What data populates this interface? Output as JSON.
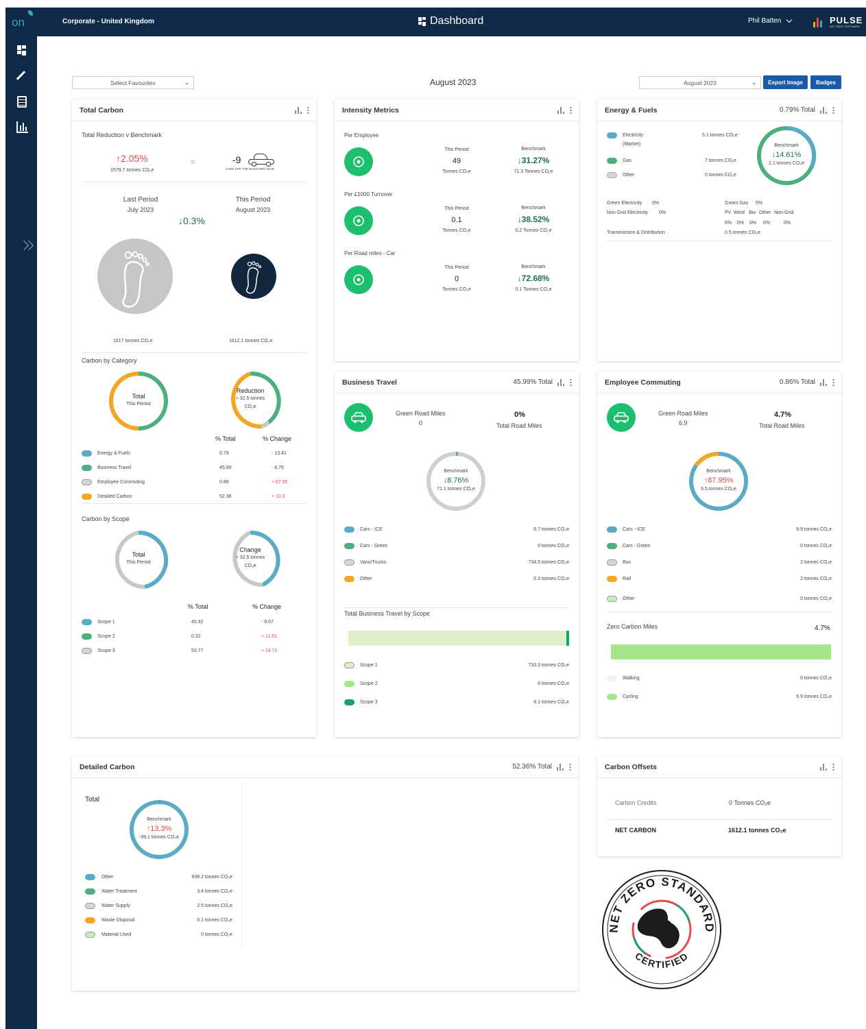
{
  "topbar": {
    "logo": "on",
    "org": "Corporate - United Kingdom",
    "title": "Dashboard",
    "user": "Phil Batten",
    "brand": "PULSE",
    "brand_sub": "NET ZERO SOFTWARE"
  },
  "controls": {
    "favourites": "Select Favourites",
    "period_heading": "August 2023",
    "period_select": "August 2023",
    "export_label": "Export Image",
    "badges_label": "Badges"
  },
  "total_carbon": {
    "title": "Total Carbon",
    "reduction_label": "Total Reduction v Benchmark",
    "pct": "↑2.05%",
    "pct_tonnes": "1579.7 tonnes CO₂e",
    "equals": "=",
    "cars": "-9",
    "cars_label": "CARS OFF THE ROAD PER YEAR",
    "last_label": "Last Period",
    "last_month": "July 2023",
    "this_label": "This Period",
    "this_month": "August 2023",
    "change": "↓0.3%",
    "last_tonnes": "1617 tonnes CO₂e",
    "this_tonnes": "1612.1 tonnes CO₂e",
    "cat_heading": "Carbon by Category",
    "donut_total": "Total",
    "donut_total_sub": "This Period",
    "donut_red": "Reduction",
    "donut_red_sub": "+ 32.5 tonnes",
    "donut_red_sub2": "CO₂e",
    "col_total": "% Total",
    "col_change": "% Change",
    "categories": [
      {
        "name": "Energy & Fuels",
        "total": "0.79",
        "change": "- 13.41"
      },
      {
        "name": "Business Travel",
        "total": "45.99",
        "change": "- 8.76"
      },
      {
        "name": "Employee Commuting",
        "total": "0.86",
        "change": "+ 87.95"
      },
      {
        "name": "Detailed Carbon",
        "total": "52.36",
        "change": "+ 13.3"
      }
    ],
    "scope_heading": "Carbon by Scope",
    "donut2_total": "Total",
    "donut2_total_sub": "This Period",
    "donut2_change": "Change",
    "donut2_change_sub": "+ 32.5 tonnes",
    "donut2_change_sub2": "CO₂e",
    "col2_total": "% Total",
    "col2_change": "% Change",
    "scopes": [
      {
        "name": "Scope 1",
        "total": "45.92",
        "change": "- 9.67"
      },
      {
        "name": "Scope 2",
        "total": "0.32",
        "change": "+ 11.81"
      },
      {
        "name": "Scope 3",
        "total": "53.77",
        "change": "+ 14.71"
      }
    ]
  },
  "intensity": {
    "title": "Intensity Metrics",
    "rows": [
      {
        "label": "Per Employee",
        "this_label": "This Period",
        "this_val": "49",
        "this_unit": "Tonnes CO₂e",
        "bench_label": "Benchmark",
        "bench_val": "↓31.27%",
        "bench_unit": "71.3 Tonnes CO₂e"
      },
      {
        "label": "Per £1000 Turnover",
        "this_label": "This Period",
        "this_val": "0.1",
        "this_unit": "Tonnes CO₂e",
        "bench_label": "Benchmark",
        "bench_val": "↓38.52%",
        "bench_unit": "0.2 Tonnes CO₂e"
      },
      {
        "label": "Per Road miles - Car",
        "this_label": "This Period",
        "this_val": "0",
        "this_unit": "Tonnes CO₂e",
        "bench_label": "Benchmark",
        "bench_val": "↓72.68%",
        "bench_unit": "0.1 Tonnes CO₂e"
      }
    ]
  },
  "energy": {
    "title": "Energy & Fuels",
    "total": "0.79% Total",
    "items": [
      {
        "name": "Electricity",
        "name2": "(Market)",
        "val": "5.1 tonnes CO₂e"
      },
      {
        "name": "Gas",
        "val": "7 tonnes CO₂e"
      },
      {
        "name": "Other",
        "val": "0 tonnes CO₂e"
      }
    ],
    "bench_label": "Benchmark",
    "bench_val": "↓14.61%",
    "bench_sub": "2.1 tonnes CO₂e",
    "green_elec": "Green Electricity",
    "green_elec_v": "0%",
    "non_grid": "Non Grid Electricity",
    "non_grid_v": "0%",
    "green_gas": "Green Gas",
    "green_gas_v": "0%",
    "renew_head": [
      "PV",
      "Wind",
      "Bio",
      "Other",
      "Non-Grid"
    ],
    "renew_vals": [
      "0%",
      "0%",
      "0%",
      "0%",
      "0%"
    ],
    "td": "Transmission & Distribution",
    "td_v": "0.5 tonnes CO₂e"
  },
  "business": {
    "title": "Business Travel",
    "total": "45.99% Total",
    "green_label": "Green Road Miles",
    "green_val": "0",
    "road_pct": "0%",
    "road_label": "Total Road Miles",
    "bench_label": "Benchmark",
    "bench_val": "↓8.76%",
    "bench_sub": "71.1 tonnes CO₂e",
    "items": [
      {
        "name": "Cars - ICE",
        "val": "6.7 tonnes CO₂e"
      },
      {
        "name": "Cars - Green",
        "val": "0 tonnes CO₂e"
      },
      {
        "name": "Vans/Trucks",
        "val": "734.5 tonnes CO₂e"
      },
      {
        "name": "Other",
        "val": "0.3 tonnes CO₂e"
      }
    ],
    "scope_heading": "Total Business Travel by Scope",
    "scope1_fraction": 0.989,
    "scopes": [
      {
        "name": "Scope 1",
        "val": "733.3 tonnes CO₂e"
      },
      {
        "name": "Scope 2",
        "val": "0 tonnes CO₂e"
      },
      {
        "name": "Scope 3",
        "val": "8.1 tonnes CO₂e"
      }
    ]
  },
  "commuting": {
    "title": "Employee Commuting",
    "total": "0.86% Total",
    "green_label": "Green Road Miles",
    "green_val": "6.9",
    "road_pct": "4.7%",
    "road_label": "Total Road Miles",
    "bench_label": "Benchmark",
    "bench_val": "↑87.95%",
    "bench_sub": "6.5 tonnes CO₂e",
    "items": [
      {
        "name": "Cars - ICE",
        "val": "9.9 tonnes CO₂e"
      },
      {
        "name": "Cars - Green",
        "val": "0 tonnes CO₂e"
      },
      {
        "name": "Bus",
        "val": "2 tonnes CO₂e"
      },
      {
        "name": "Rail",
        "val": "2 tonnes CO₂e"
      },
      {
        "name": "Other",
        "val": "0 tonnes CO₂e"
      }
    ],
    "zero_label": "Zero Carbon Miles",
    "zero_val": "4.7%",
    "zero_fraction": 1.0,
    "zero_items": [
      {
        "name": "Walking",
        "val": "0 tonnes CO₂e"
      },
      {
        "name": "Cycling",
        "val": "6.9 tonnes CO₂e"
      }
    ]
  },
  "detailed": {
    "title": "Detailed Carbon",
    "total": "52.36% Total",
    "total_label": "Total",
    "bench_label": "Benchmark",
    "bench_val": "↑13.3%",
    "bench_sub": "-99.1 tonnes CO₂e",
    "items": [
      {
        "name": "Other",
        "val": "838.2 tonnes CO₂e"
      },
      {
        "name": "Water Treatment",
        "val": "3.4 tonnes CO₂e"
      },
      {
        "name": "Water Supply",
        "val": "2.5 tonnes CO₂e"
      },
      {
        "name": "Waste Disposal",
        "val": "0.1 tonnes CO₂e"
      },
      {
        "name": "Material Used",
        "val": "0 tonnes CO₂e"
      }
    ]
  },
  "offsets": {
    "title": "Carbon Offsets",
    "credits_label": "Carbon Credits",
    "credits_val": "0 Tonnes CO₂e",
    "net_label": "NET CARBON",
    "net_val": "1612.1 tonnes CO₂e"
  },
  "badge": {
    "top": "NET ZERO STANDARD",
    "bottom": "CERTIFIED"
  },
  "colors": {
    "navy": "#0e2a47",
    "blue": "#5aabc6",
    "green": "#4caf7d",
    "grey": "#c8c8c8",
    "orange": "#f5a623",
    "lightgreen": "#b9e4a6",
    "up": "#e8484b",
    "down": "#1f6e56"
  }
}
